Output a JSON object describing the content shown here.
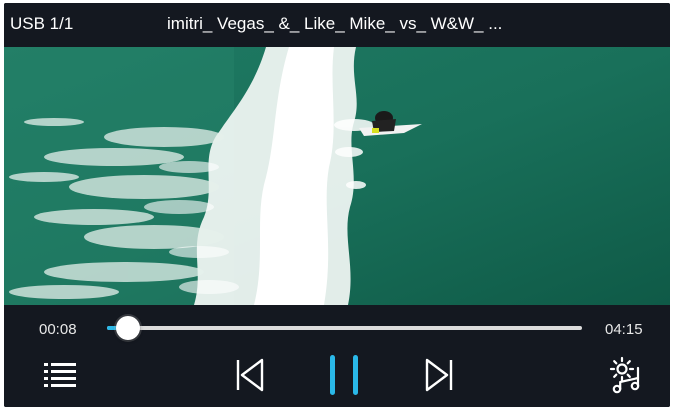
{
  "header": {
    "source": "USB  1/1",
    "title": "imitri_ Vegas_ &_ Like_ Mike_ vs_ W&W_ ..."
  },
  "playback": {
    "current_time": "00:08",
    "total_time": "04:15",
    "progress_fraction": 0.031,
    "state": "playing"
  },
  "controls": {
    "playlist_icon": "list-icon",
    "previous_icon": "skip-previous-icon",
    "pause_icon": "pause-icon",
    "next_icon": "skip-next-icon",
    "settings_icon": "audio-settings-icon"
  },
  "colors": {
    "accent": "#2ab8e8",
    "background": "#141820",
    "icon": "#ffffff"
  }
}
